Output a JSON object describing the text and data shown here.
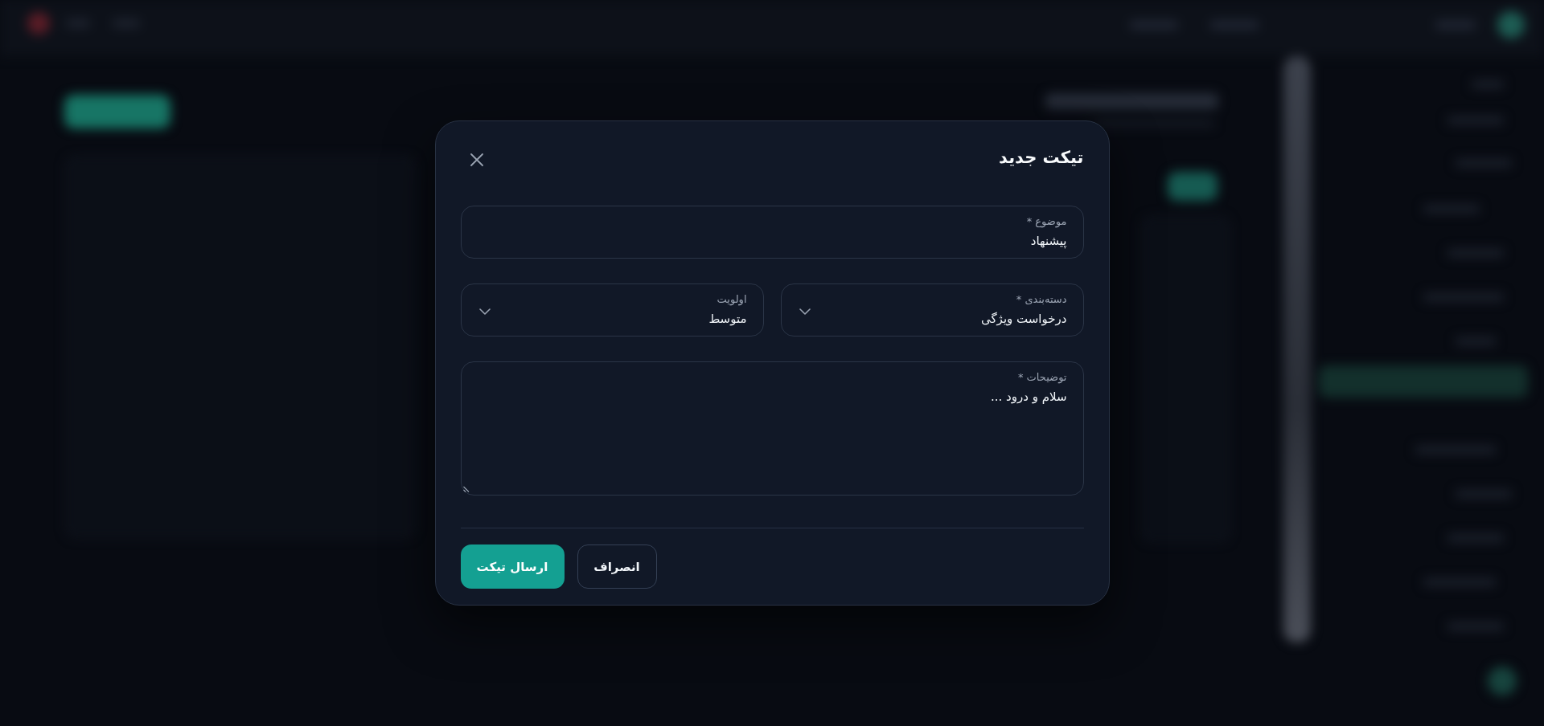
{
  "modal": {
    "title": "تیکت جدید",
    "fields": [
      {
        "kind": "text",
        "label": "موضوع *",
        "value": "پیشنهاد"
      },
      {
        "kind": "select",
        "label": "دسته‌بندی *",
        "value": "درخواست ویژگی"
      },
      {
        "kind": "select",
        "label": "اولویت",
        "value": "متوسط"
      },
      {
        "kind": "textarea",
        "label": "توضیحات *",
        "value": "سلام و درود ..."
      }
    ],
    "buttons": [
      {
        "kind": "secondary",
        "label": "انصراف"
      },
      {
        "kind": "primary",
        "label": "ارسال تیکت"
      }
    ]
  }
}
